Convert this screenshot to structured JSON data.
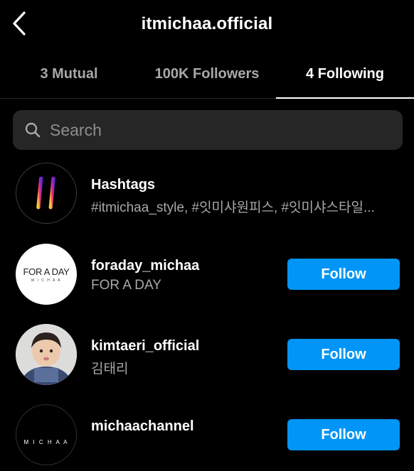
{
  "header": {
    "title": "itmichaa.official",
    "back_icon": "chevron-left-icon"
  },
  "tabs": [
    {
      "label": "3 Mutual",
      "active": false
    },
    {
      "label": "100K Followers",
      "active": false
    },
    {
      "label": "4 Following",
      "active": true
    }
  ],
  "search": {
    "placeholder": "Search",
    "value": "",
    "icon": "search-icon"
  },
  "hashtags_row": {
    "title": "Hashtags",
    "subtitle": "#itmichaa_style, #잇미샤원피스, #잇미샤스타일...",
    "icon": "hashtag-icon",
    "colors": [
      "#f9ce34",
      "#ee2a7b",
      "#6228d7"
    ]
  },
  "accounts": [
    {
      "username": "foraday_michaa",
      "subtitle": "FOR A DAY",
      "button_label": "Follow",
      "avatar_logo": "FOR A DAY",
      "avatar_logo_sub": "M I C H A A"
    },
    {
      "username": "kimtaeri_official",
      "subtitle": "김태리",
      "button_label": "Follow"
    },
    {
      "username": "michaachannel",
      "subtitle": "",
      "button_label": "Follow",
      "avatar_logo": "M I C H A A"
    }
  ],
  "colors": {
    "background": "#000000",
    "follow_button": "#0095f6",
    "search_bg": "#262626",
    "secondary_text": "#a8a8a8"
  }
}
